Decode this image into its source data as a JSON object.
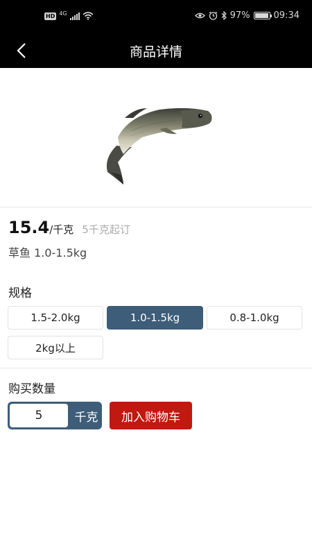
{
  "status_bar": {
    "hd": "HD",
    "network": "4G",
    "battery_percent": "97%",
    "battery_level": 0.97,
    "time": "09:34",
    "icons": [
      "signal-icon",
      "wifi-icon",
      "eye-icon",
      "alarm-icon",
      "bluetooth-icon",
      "battery-icon"
    ]
  },
  "nav": {
    "title": "商品详情",
    "back_icon": "chevron-left-icon"
  },
  "product": {
    "image": "grass-carp-fish",
    "price": "15.4",
    "price_unit": "/千克",
    "min_order": "5千克起订",
    "name": "草鱼 1.0-1.5kg"
  },
  "spec": {
    "label": "规格",
    "options": [
      "1.5-2.0kg",
      "1.0-1.5kg",
      "0.8-1.0kg",
      "2kg以上"
    ],
    "selected": "1.0-1.5kg"
  },
  "quantity": {
    "label": "购买数量",
    "value": "5",
    "unit": "千克"
  },
  "actions": {
    "add_to_cart": "加入购物车"
  },
  "colors": {
    "accent": "#3d5d79",
    "cart_button": "#c0190f",
    "header_bg": "#000000"
  }
}
